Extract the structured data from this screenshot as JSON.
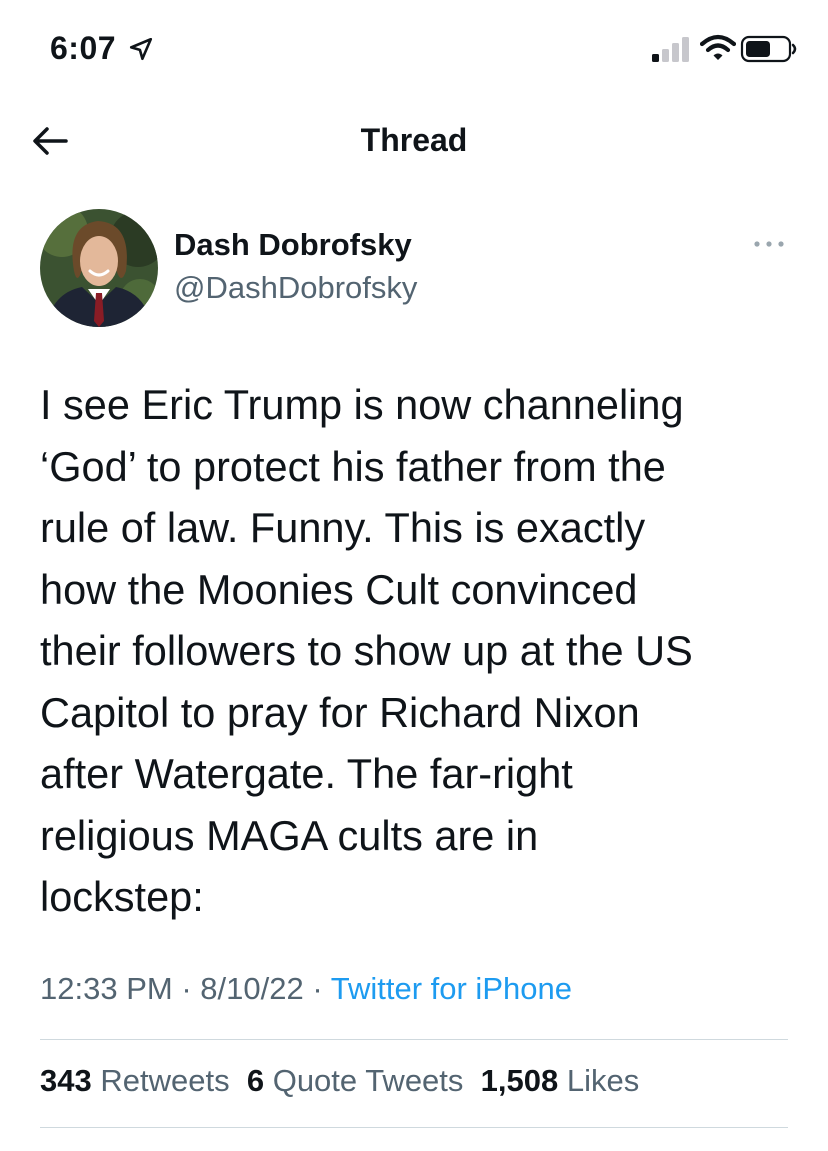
{
  "status_bar": {
    "time": "6:07",
    "location_icon": "location-arrow-icon",
    "signal_icon": "cellular-signal-icon",
    "wifi_icon": "wifi-icon",
    "battery_icon": "battery-icon"
  },
  "nav": {
    "back_icon": "back-arrow-icon",
    "title": "Thread"
  },
  "tweet": {
    "author_name": "Dash Dobrofsky",
    "author_handle": "@DashDobrofsky",
    "more_icon": "more-options-icon",
    "text": "I see Eric Trump is now channeling\n‘God’ to protect his father from the\nrule of law. Funny. This is exactly\nhow the Moonies Cult convinced\ntheir followers to show up at the US\nCapitol to pray for Richard Nixon\nafter Watergate. The far-right\nreligious MAGA cults are in\nlockstep:",
    "time": "12:33 PM",
    "separator": "·",
    "date": "8/10/22",
    "source": "Twitter for iPhone"
  },
  "stats": {
    "retweets_count": "343",
    "retweets_label": "Retweets",
    "quotes_count": "6",
    "quotes_label": "Quote Tweets",
    "likes_count": "1,508",
    "likes_label": "Likes"
  },
  "colors": {
    "text": "#0f1419",
    "secondary": "#536471",
    "link": "#1d9bf0",
    "divider": "#cfd9de"
  }
}
